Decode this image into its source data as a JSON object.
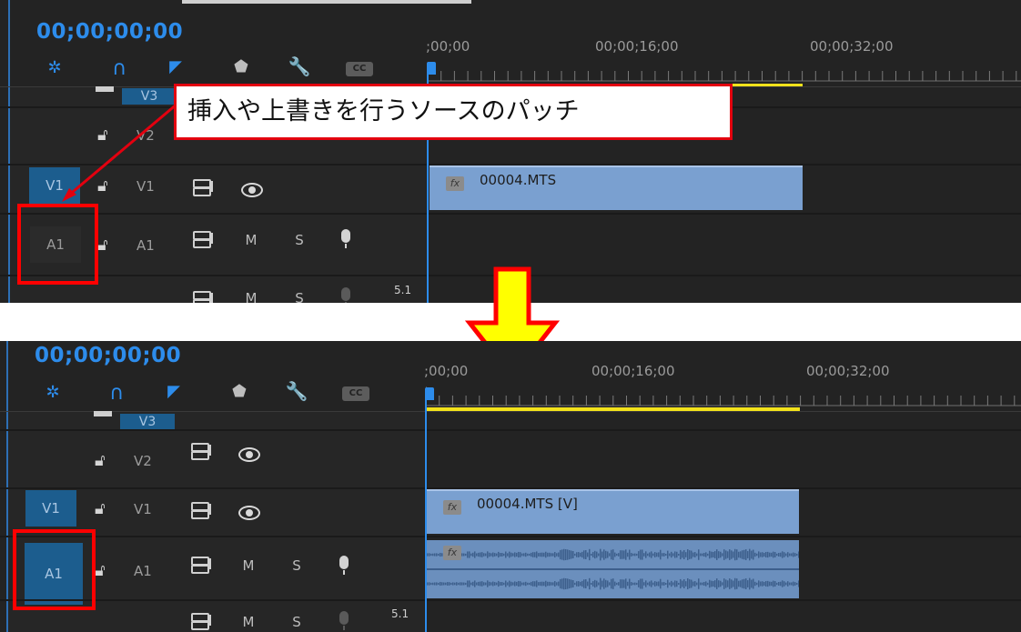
{
  "top_panel": {
    "timecode": "00;00;00;00",
    "ruler_labels": [
      ";00;00",
      "00;00;16;00",
      "00;00;32;00"
    ],
    "tools": {
      "snap": "snap-icon",
      "magnet": "magnet-icon",
      "linked_selection": "linked-selection-icon",
      "marker": "marker-icon",
      "wrench": "wrench-icon",
      "captions": "CC"
    },
    "tracks": {
      "v3_name": "V3",
      "v2_name": "V2",
      "v1_patch": "V1",
      "v1_name": "V1",
      "a1_patch": "A1",
      "a1_name": "A1",
      "a1_mute": "M",
      "a1_solo": "S",
      "a2_mute": "M",
      "a2_solo": "S",
      "a2_channels": "5.1"
    },
    "clip_video_name": "00004.MTS",
    "clip_fx_badge": "fx",
    "callout_text": "挿入や上書きを行うソースのパッチ"
  },
  "bottom_panel": {
    "timecode": "00;00;00;00",
    "ruler_labels": [
      ";00;00",
      "00;00;16;00",
      "00;00;32;00"
    ],
    "tools": {
      "snap": "snap-icon",
      "magnet": "magnet-icon",
      "linked_selection": "linked-selection-icon",
      "marker": "marker-icon",
      "wrench": "wrench-icon",
      "captions": "CC"
    },
    "tracks": {
      "v3_name": "V3",
      "v2_name": "V2",
      "v1_patch": "V1",
      "v1_name": "V1",
      "a1_patch": "A1",
      "a1_name": "A1",
      "a1_mute": "M",
      "a1_solo": "S",
      "a2_mute": "M",
      "a2_solo": "S",
      "a2_channels": "5.1"
    },
    "clip_video_name": "00004.MTS [V]",
    "clip_fx_badge": "fx",
    "audio_fx_badge": "fx"
  },
  "colors": {
    "accent_blue": "#2d8ceb",
    "highlight_red": "#ff0000",
    "arrow_yellow": "#ffff00",
    "work_area_yellow": "#f2e21b",
    "patch_active": "#1c5d8e",
    "clip_video": "#7aa0d0"
  }
}
